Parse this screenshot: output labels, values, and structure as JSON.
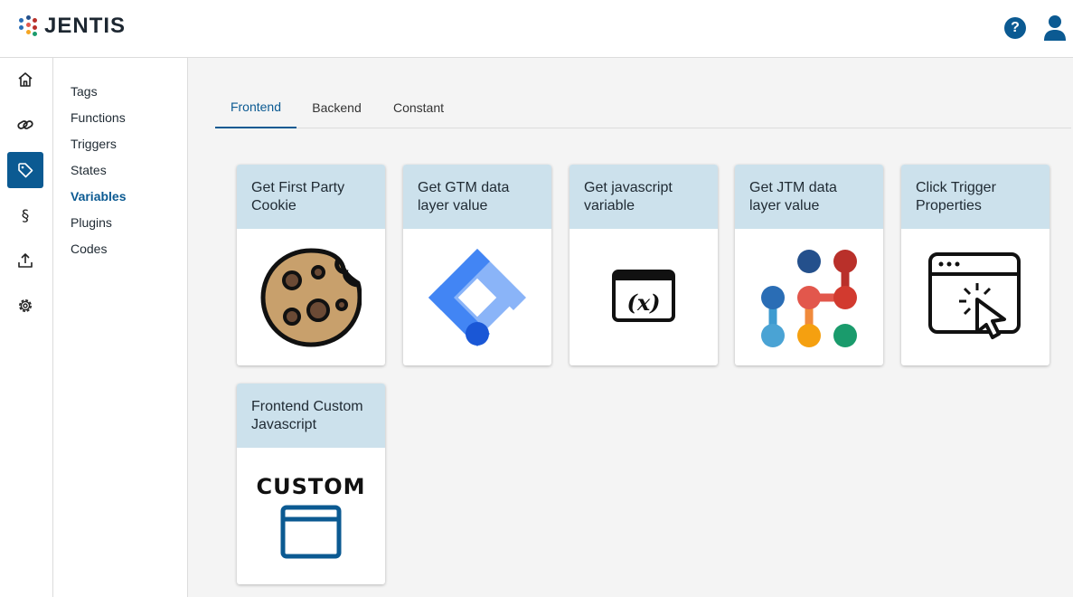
{
  "header": {
    "logo_text": "JENTIS",
    "help_label": "?"
  },
  "rail": {
    "items": [
      {
        "icon": "home-icon"
      },
      {
        "icon": "link-icon"
      },
      {
        "icon": "tag-icon"
      },
      {
        "icon": "section-icon"
      },
      {
        "icon": "upload-icon"
      },
      {
        "icon": "settings-icon"
      }
    ]
  },
  "subnav": {
    "items": [
      {
        "label": "Tags"
      },
      {
        "label": "Functions"
      },
      {
        "label": "Triggers"
      },
      {
        "label": "States"
      },
      {
        "label": "Variables",
        "active": true
      },
      {
        "label": "Plugins"
      },
      {
        "label": "Codes"
      }
    ]
  },
  "tabs": [
    {
      "label": "Frontend",
      "active": true
    },
    {
      "label": "Backend"
    },
    {
      "label": "Constant"
    }
  ],
  "cards": [
    {
      "title": "Get First Party Cookie",
      "icon": "cookie-icon"
    },
    {
      "title": "Get GTM data layer value",
      "icon": "google-tag-manager-icon"
    },
    {
      "title": "Get javascript variable",
      "icon": "variable-window-icon"
    },
    {
      "title": "Get JTM data layer value",
      "icon": "jentis-logo-icon"
    },
    {
      "title": "Click Trigger Properties",
      "icon": "click-window-icon"
    },
    {
      "title": "Frontend Custom Javascript",
      "icon": "custom-window-icon",
      "image_text": "CUSTOM"
    }
  ],
  "colors": {
    "accent": "#0b5a92",
    "card_header": "#cce1ec"
  }
}
